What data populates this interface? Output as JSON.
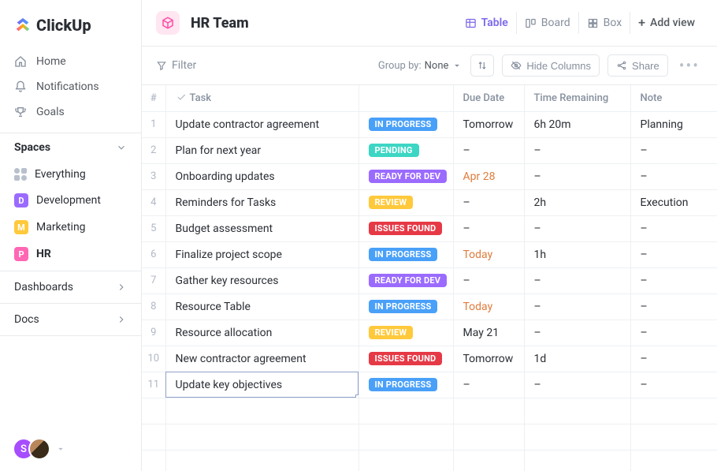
{
  "logo": "ClickUp",
  "nav": {
    "home": "Home",
    "notifications": "Notifications",
    "goals": "Goals"
  },
  "spaces_header": "Spaces",
  "everything_label": "Everything",
  "spaces": [
    {
      "label": "Development",
      "initial": "D",
      "color": "#9b6bff"
    },
    {
      "label": "Marketing",
      "initial": "M",
      "color": "#ffc93c"
    },
    {
      "label": "HR",
      "initial": "P",
      "color": "#ff66b3",
      "active": true
    }
  ],
  "bottom_nav": {
    "dashboards": "Dashboards",
    "docs": "Docs"
  },
  "footer": {
    "avatar1_initial": "S"
  },
  "header": {
    "title": "HR Team",
    "views": {
      "table": "Table",
      "board": "Board",
      "box": "Box",
      "add": "Add view"
    }
  },
  "toolbar": {
    "filter": "Filter",
    "group_by_label": "Group by:",
    "group_by_value": "None",
    "hide_columns": "Hide Columns",
    "share": "Share"
  },
  "columns": {
    "num": "#",
    "task": "Task",
    "due": "Due Date",
    "remaining": "Time Remaining",
    "note": "Note"
  },
  "status_labels": {
    "inprogress": "IN PROGRESS",
    "pending": "PENDING",
    "ready": "READY FOR DEV",
    "review": "REVIEW",
    "issues": "ISSUES FOUND"
  },
  "rows": [
    {
      "n": "1",
      "task": "Update contractor agreement",
      "status": "inprogress",
      "due": "Tomorrow",
      "due_warn": false,
      "rem": "6h 20m",
      "note": "Planning"
    },
    {
      "n": "2",
      "task": "Plan for next year",
      "status": "pending",
      "due": "–",
      "due_warn": false,
      "rem": "–",
      "note": "–"
    },
    {
      "n": "3",
      "task": "Onboarding updates",
      "status": "ready",
      "due": "Apr 28",
      "due_warn": true,
      "rem": "–",
      "note": "–"
    },
    {
      "n": "4",
      "task": "Reminders for Tasks",
      "status": "review",
      "due": "–",
      "due_warn": false,
      "rem": "2h",
      "note": "Execution"
    },
    {
      "n": "5",
      "task": "Budget assessment",
      "status": "issues",
      "due": "–",
      "due_warn": false,
      "rem": "–",
      "note": "–"
    },
    {
      "n": "6",
      "task": "Finalize project scope",
      "status": "inprogress",
      "due": "Today",
      "due_warn": true,
      "rem": "1h",
      "note": "–"
    },
    {
      "n": "7",
      "task": "Gather key resources",
      "status": "ready",
      "due": "–",
      "due_warn": false,
      "rem": "–",
      "note": "–"
    },
    {
      "n": "8",
      "task": "Resource Table",
      "status": "inprogress",
      "due": "Today",
      "due_warn": true,
      "rem": "–",
      "note": "–"
    },
    {
      "n": "9",
      "task": "Resource allocation",
      "status": "review",
      "due": "May 21",
      "due_warn": false,
      "rem": "–",
      "note": "–"
    },
    {
      "n": "10",
      "task": "New contractor agreement",
      "status": "issues",
      "due": "Tomorrow",
      "due_warn": false,
      "rem": "1d",
      "note": "–"
    },
    {
      "n": "11",
      "task": "Update key objectives",
      "status": "inprogress",
      "due": "–",
      "due_warn": false,
      "rem": "–",
      "note": "–",
      "selected": true
    }
  ]
}
